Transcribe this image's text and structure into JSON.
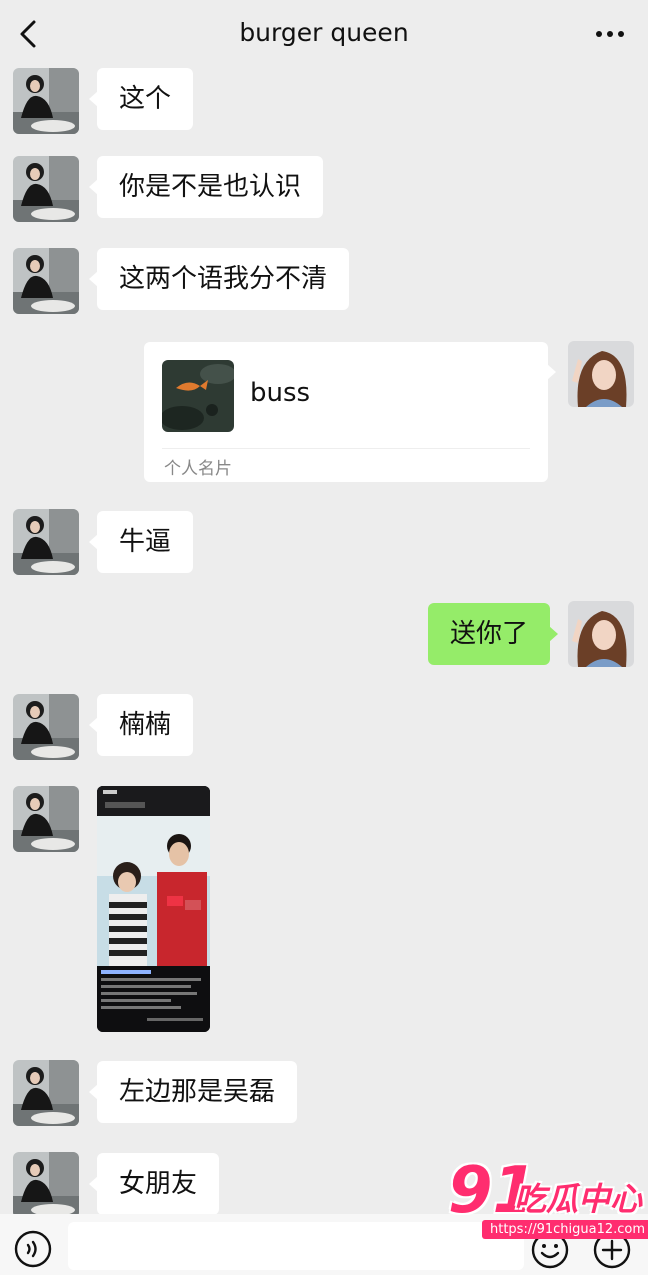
{
  "header": {
    "title": "burger queen",
    "back_icon": "chevron-left-icon",
    "more_icon": "more-horizontal-icon"
  },
  "messages": [
    {
      "side": "left",
      "type": "text",
      "text": "这个"
    },
    {
      "side": "left",
      "type": "text",
      "text": "你是不是也认识"
    },
    {
      "side": "left",
      "type": "text",
      "text": "这两个语我分不清"
    },
    {
      "side": "right",
      "type": "contact-card",
      "name": "buss",
      "card_label": "个人名片"
    },
    {
      "side": "left",
      "type": "text",
      "text": "牛逼"
    },
    {
      "side": "right",
      "type": "text",
      "text": "送你了"
    },
    {
      "side": "left",
      "type": "text",
      "text": "楠楠"
    },
    {
      "side": "left",
      "type": "image"
    },
    {
      "side": "left",
      "type": "text",
      "text": "左边那是吴磊"
    },
    {
      "side": "left",
      "type": "text",
      "text": "女朋友"
    }
  ],
  "input_bar": {
    "voice_icon": "voice-icon",
    "emoji_icon": "emoji-icon",
    "plus_icon": "plus-circle-icon",
    "placeholder": ""
  },
  "watermark": {
    "number": "91",
    "brand": "吃瓜中心",
    "url": "https://91chigua12.com"
  },
  "colors": {
    "background": "#ededed",
    "incoming_bubble": "#ffffff",
    "outgoing_bubble": "#95ec69",
    "watermark": "#ff2d6f"
  }
}
